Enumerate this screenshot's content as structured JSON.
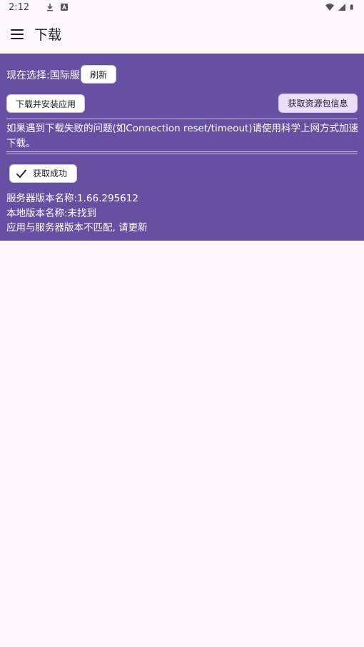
{
  "status_bar": {
    "time": "2:12",
    "left_icons": [
      "download-icon",
      "a-icon"
    ],
    "right_icons": [
      "wifi-icon",
      "cell-signal-icon",
      "battery-icon"
    ]
  },
  "app_bar": {
    "title": "下载",
    "menu_icon": "menu-icon"
  },
  "panel": {
    "background_color": "#6750a4",
    "selection_label": "现在选择:国际服",
    "refresh_button": "刷新",
    "download_install_button": "下载并安装应用",
    "fetch_resource_button": "获取资源包信息",
    "notice": "如果遇到下载失败的问题(如Connection reset/timeout)请使用科学上网方式加速下载。",
    "success_chip": "获取成功",
    "server_version": "服务器版本名称:1.66.295612",
    "local_version": "本地版本名称:未找到",
    "mismatch_message": "应用与服务器版本不匹配, 请更新"
  }
}
